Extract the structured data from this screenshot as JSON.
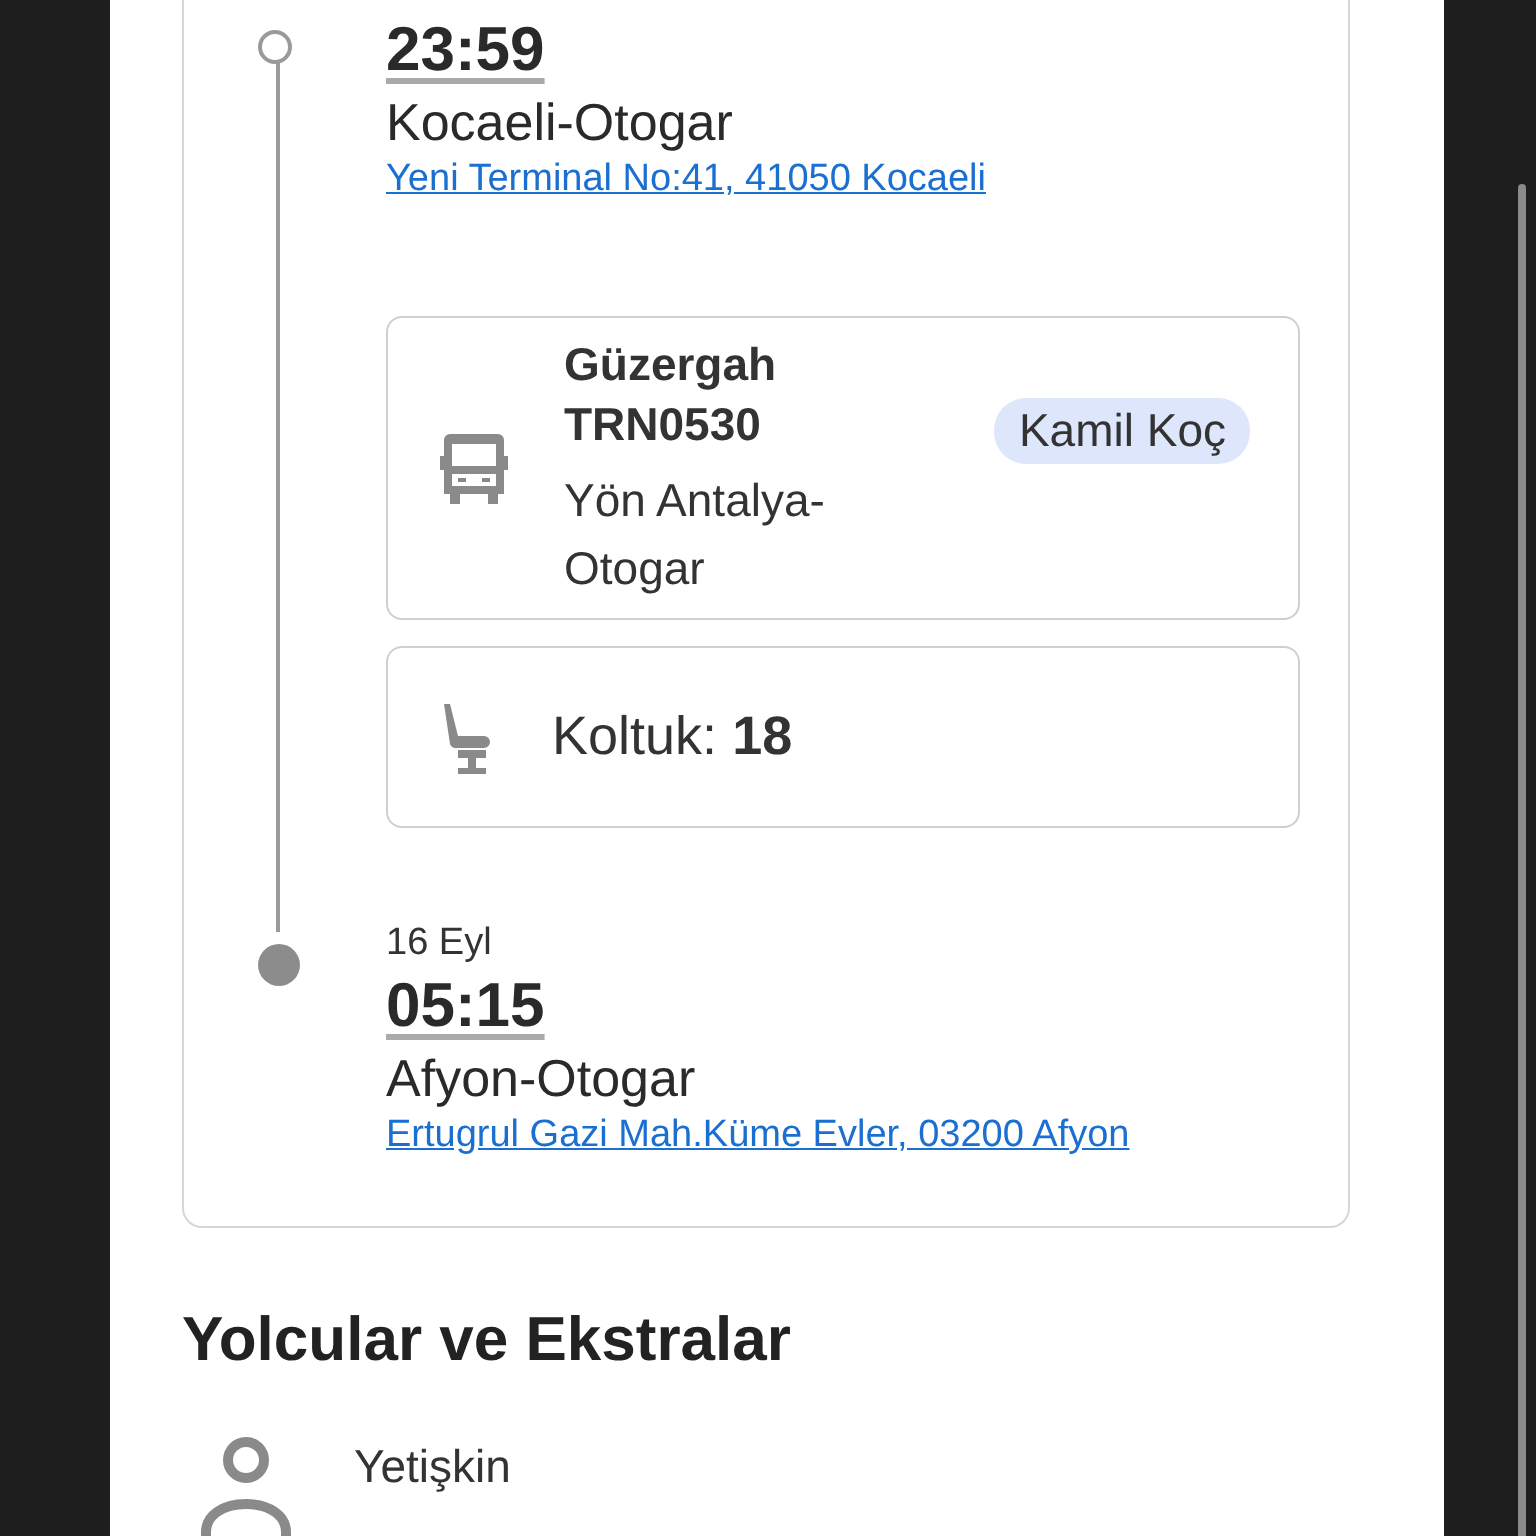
{
  "departure": {
    "time": "23:59",
    "station": "Kocaeli-Otogar",
    "address": "Yeni Terminal No:41, 41050 Kocaeli"
  },
  "route_card": {
    "label": "Güzergah",
    "code": "TRN0530",
    "direction": "Yön Antalya-Otogar",
    "operator": "Kamil Koç"
  },
  "seat_card": {
    "label": "Koltuk:",
    "number": "18"
  },
  "arrival": {
    "date": "16 Eyl",
    "time": "05:15",
    "station": "Afyon-Otogar",
    "address": "Ertugrul Gazi Mah.Küme Evler, 03200 Afyon"
  },
  "passengers": {
    "title": "Yolcular ve Ekstralar",
    "items": [
      {
        "type": "Yetişkin"
      }
    ]
  }
}
